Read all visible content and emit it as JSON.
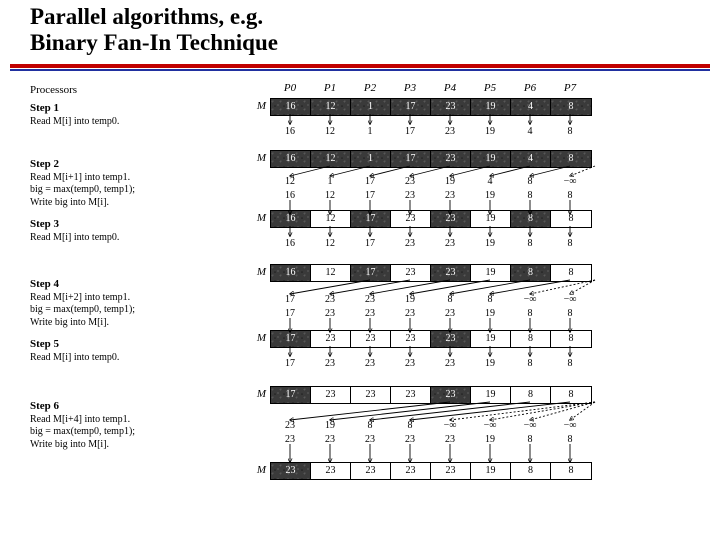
{
  "title_line1": "Parallel algorithms, e.g.",
  "title_line2": "Binary Fan-In Technique",
  "processors_label": "Processors",
  "proc_names": [
    "P0",
    "P1",
    "P2",
    "P3",
    "P4",
    "P5",
    "P6",
    "P7"
  ],
  "M_label": "M",
  "neg_inf": "−∞",
  "step1": {
    "name": "Step 1",
    "t1": "Read M[i] into temp0.",
    "M": [
      16,
      12,
      1,
      17,
      23,
      19,
      4,
      8
    ],
    "vals": [
      16,
      12,
      1,
      17,
      23,
      19,
      4,
      8
    ]
  },
  "step2": {
    "name": "Step 2",
    "t1": "Read M[i+1] into temp1.",
    "t2": "big = max(temp0, temp1);",
    "t3": "Write big into M[i].",
    "vals_read": [
      12,
      1,
      17,
      23,
      19,
      4,
      8,
      "−∞"
    ],
    "vals_big": [
      16,
      12,
      17,
      23,
      23,
      19,
      8,
      8
    ]
  },
  "step3": {
    "name": "Step 3",
    "t1": "Read M[i] into temp0.",
    "M": [
      16,
      12,
      17,
      23,
      23,
      19,
      8,
      8
    ],
    "vals": [
      16,
      12,
      17,
      23,
      23,
      19,
      8,
      8
    ]
  },
  "step4": {
    "name": "Step 4",
    "t1": "Read M[i+2] into temp1.",
    "t2": "big = max(temp0, temp1);",
    "t3": "Write big into M[i].",
    "M_prev": [
      16,
      12,
      17,
      23,
      23,
      19,
      8,
      8
    ],
    "vals_read": [
      17,
      23,
      23,
      19,
      8,
      8,
      "−∞",
      "−∞"
    ],
    "vals_big": [
      17,
      23,
      23,
      23,
      23,
      19,
      8,
      8
    ]
  },
  "step5": {
    "name": "Step 5",
    "t1": "Read M[i] into temp0.",
    "M": [
      17,
      23,
      23,
      23,
      23,
      19,
      8,
      8
    ],
    "vals": [
      17,
      23,
      23,
      23,
      23,
      19,
      8,
      8
    ]
  },
  "step6": {
    "name": "Step 6",
    "t1": "Read M[i+4] into temp1.",
    "t2": "big = max(temp0, temp1);",
    "t3": "Write big into M[i].",
    "M_prev": [
      17,
      23,
      23,
      23,
      23,
      19,
      8,
      8
    ],
    "vals_read": [
      23,
      19,
      8,
      8,
      "−∞",
      "−∞",
      "−∞",
      "−∞"
    ],
    "vals_big": [
      23,
      23,
      23,
      23,
      23,
      19,
      8,
      8
    ],
    "M_final": [
      23,
      23,
      23,
      23,
      23,
      19,
      8,
      8
    ]
  },
  "chart_data": {
    "type": "table",
    "title": "Binary Fan-In parallel maximum over 8 processors",
    "processors": [
      0,
      1,
      2,
      3,
      4,
      5,
      6,
      7
    ],
    "initial": [
      16,
      12,
      1,
      17,
      23,
      19,
      4,
      8
    ],
    "after_step2": [
      16,
      12,
      17,
      23,
      23,
      19,
      8,
      8
    ],
    "after_step4": [
      17,
      23,
      23,
      23,
      23,
      19,
      8,
      8
    ],
    "after_step6": [
      23,
      23,
      23,
      23,
      23,
      19,
      8,
      8
    ],
    "answer": 23
  }
}
